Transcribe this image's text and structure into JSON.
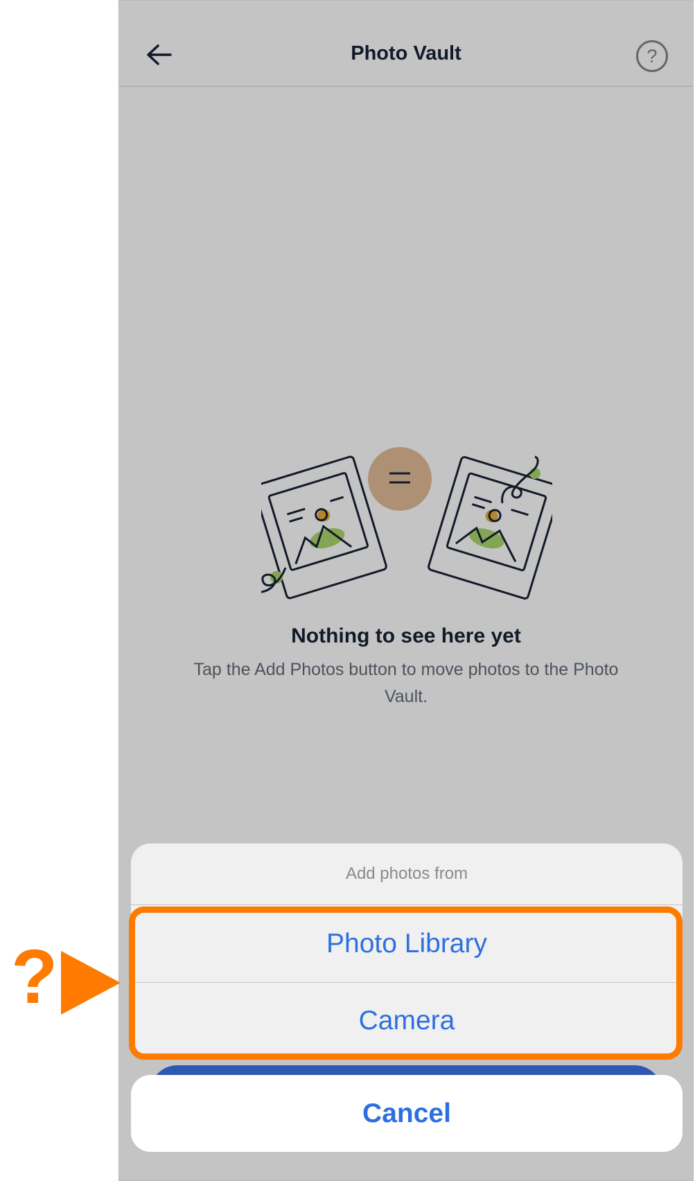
{
  "nav": {
    "title": "Photo Vault",
    "back_icon": "arrow-left-icon",
    "help_label": "?"
  },
  "empty_state": {
    "title": "Nothing to see here yet",
    "description": "Tap the Add Photos button to move photos to the Photo Vault."
  },
  "action_sheet": {
    "header": "Add photos from",
    "options": [
      {
        "label": "Photo Library"
      },
      {
        "label": "Camera"
      }
    ],
    "cancel_label": "Cancel"
  },
  "annotation": {
    "marker": "?",
    "color": "#ff7a00"
  },
  "colors": {
    "accent": "#2e6fe0",
    "title_text": "#162133",
    "highlight": "#ff7a00"
  }
}
